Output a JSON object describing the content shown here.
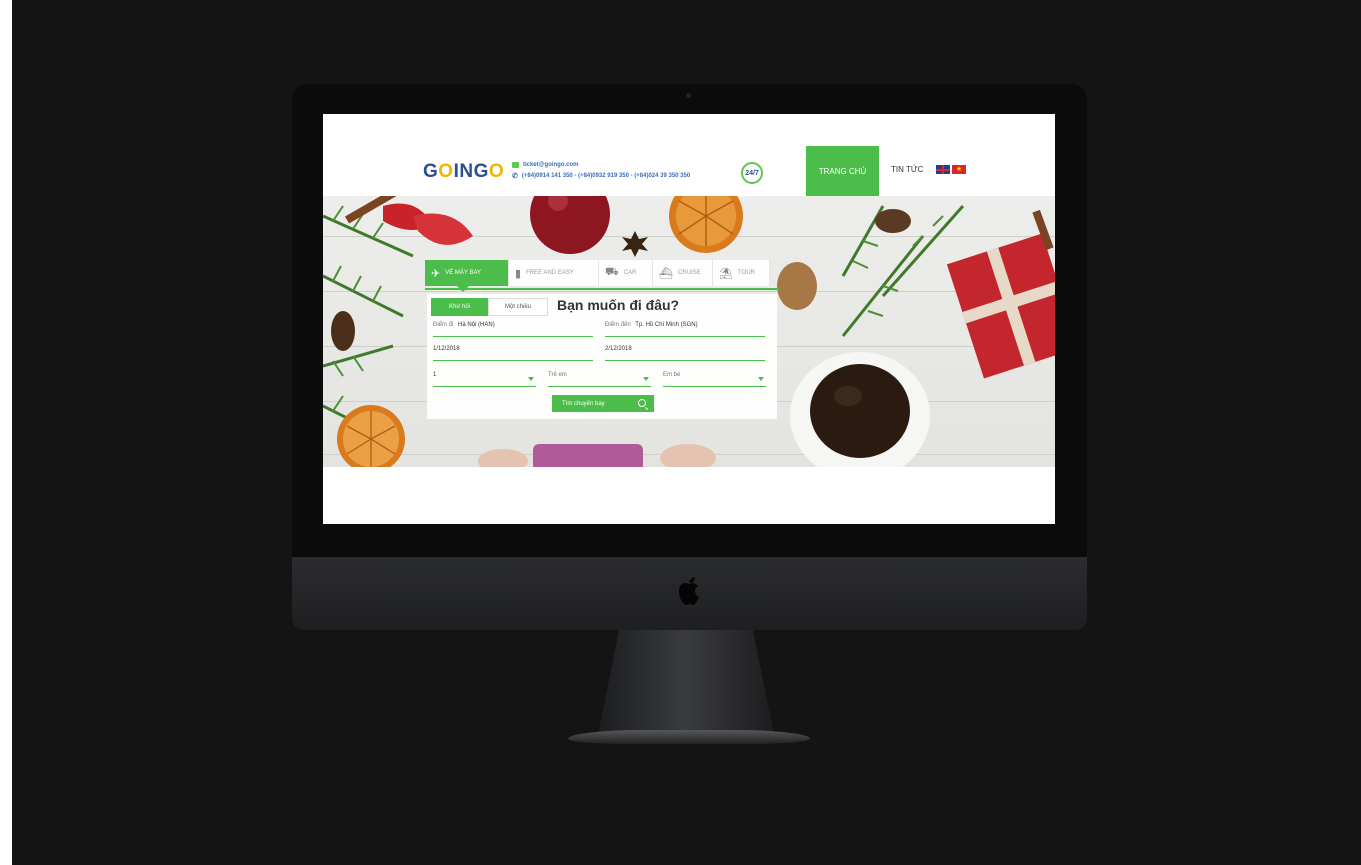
{
  "header": {
    "logo": "GOINGO",
    "email": "ticket@goingo.com",
    "phones": "(+84)0914 141 350 - (+84)0932 919 350 - (+84)024 39 350 350",
    "support_badge": "24/7",
    "nav": {
      "home": "TRANG CHỦ",
      "news": "TIN TỨC"
    },
    "languages": [
      "en-flag-icon",
      "vn-flag-icon"
    ]
  },
  "search_tabs": [
    {
      "label": "VÉ MÁY BAY",
      "icon": "plane-icon",
      "active": true
    },
    {
      "label": "FREE AND EASY",
      "icon": "hotel-icon",
      "active": false
    },
    {
      "label": "CAR",
      "icon": "car-icon",
      "active": false
    },
    {
      "label": "CRUISE",
      "icon": "ship-icon",
      "active": false
    },
    {
      "label": "TOUR",
      "icon": "beach-icon",
      "active": false
    }
  ],
  "search_form": {
    "round_trip": "Khứ hồi",
    "one_way": "Một chiều",
    "question": "Bạn muốn đi đâu?",
    "from_label": "Điểm đi",
    "from_value": "Hà Nội (HAN)",
    "to_label": "Điểm đến",
    "to_value": "Tp. Hồ Chí Minh (SGN)",
    "depart_date": "1/12/2018",
    "return_date": "2/12/2018",
    "adults": "1",
    "children_label": "Trẻ em",
    "infants_label": "Em bé",
    "submit": "Tìm chuyến bay"
  },
  "colors": {
    "accent": "#4cbc4a",
    "brand_blue": "#2d4f8e",
    "background": "#141414"
  }
}
